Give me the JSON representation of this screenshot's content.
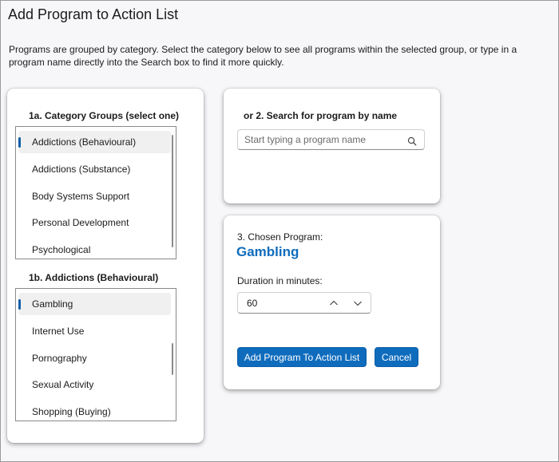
{
  "window": {
    "title": "Add Program to Action List",
    "description": "Programs are grouped by category. Select the category below to see all programs within the selected group, or type in a program name directly into the Search box to find it more quickly."
  },
  "categories": {
    "label": "1a. Category Groups (select one)",
    "items": [
      "Addictions (Behavioural)",
      "Addictions (Substance)",
      "Body Systems Support",
      "Personal Development",
      "Psychological"
    ],
    "selected_index": 0
  },
  "programs": {
    "label": "1b. Addictions (Behavioural)",
    "items": [
      "Gambling",
      "Internet Use",
      "Pornography",
      "Sexual Activity",
      "Shopping (Buying)"
    ],
    "selected_index": 0
  },
  "search": {
    "label": "or 2. Search for program by name",
    "placeholder": "Start typing a program name",
    "icon": "search-icon"
  },
  "chosen": {
    "label": "3. Chosen Program:",
    "program_name": "Gambling",
    "duration_label": "Duration in minutes:",
    "duration_value": "60"
  },
  "buttons": {
    "add_label": "Add Program To Action List",
    "cancel_label": "Cancel"
  },
  "colors": {
    "accent": "#0f6cbd",
    "selection_bar": "#0f5fa8"
  }
}
